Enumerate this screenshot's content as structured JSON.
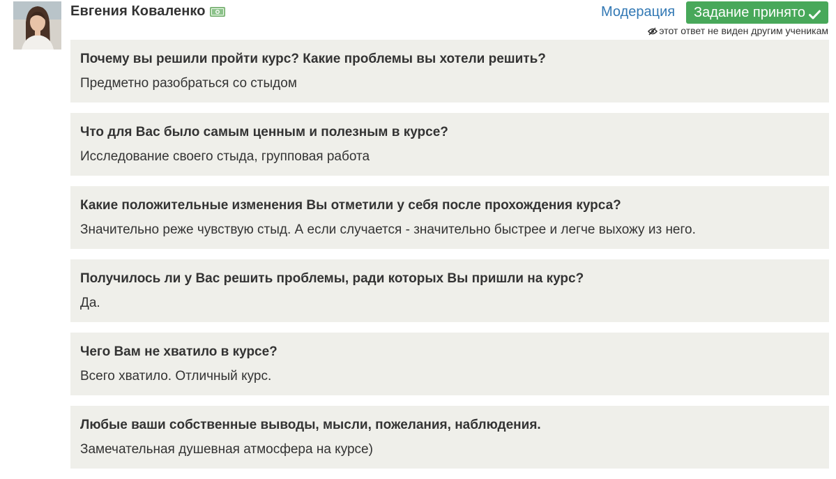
{
  "author": {
    "name": "Евгения Коваленко",
    "avatar_icon": "user-photo",
    "badge_icon": "money-icon",
    "badge_color": "#8bc28a"
  },
  "actions": {
    "moderation_label": "Модерация",
    "accepted_label": "Задание принято",
    "accepted_icon": "check-icon",
    "accent_color": "#48a85a",
    "link_color": "#3278b4"
  },
  "note": {
    "icon": "eye-off-icon",
    "text": "этот ответ не виден другим ученикам"
  },
  "qa": [
    {
      "question": "Почему вы решили пройти курс? Какие проблемы вы хотели решить?",
      "answer": "Предметно разобраться со стыдом"
    },
    {
      "question": "Что для Вас было самым ценным и полезным в курсе?",
      "answer": "Исследование своего стыда, групповая работа"
    },
    {
      "question": "Какие положительные изменения Вы отметили у себя после прохождения курса?",
      "answer": "Значительно реже чувствую стыд. А если случается - значительно быстрее и легче выхожу из него."
    },
    {
      "question": "Получилось ли у Вас решить проблемы, ради которых Вы пришли на курс?",
      "answer": "Да."
    },
    {
      "question": "Чего Вам не хватило в курсе?",
      "answer": "Всего хватило. Отличный курс."
    },
    {
      "question": "Любые ваши собственные выводы, мысли, пожелания, наблюдения.",
      "answer": "Замечательная душевная атмосфера на курсе)"
    }
  ]
}
